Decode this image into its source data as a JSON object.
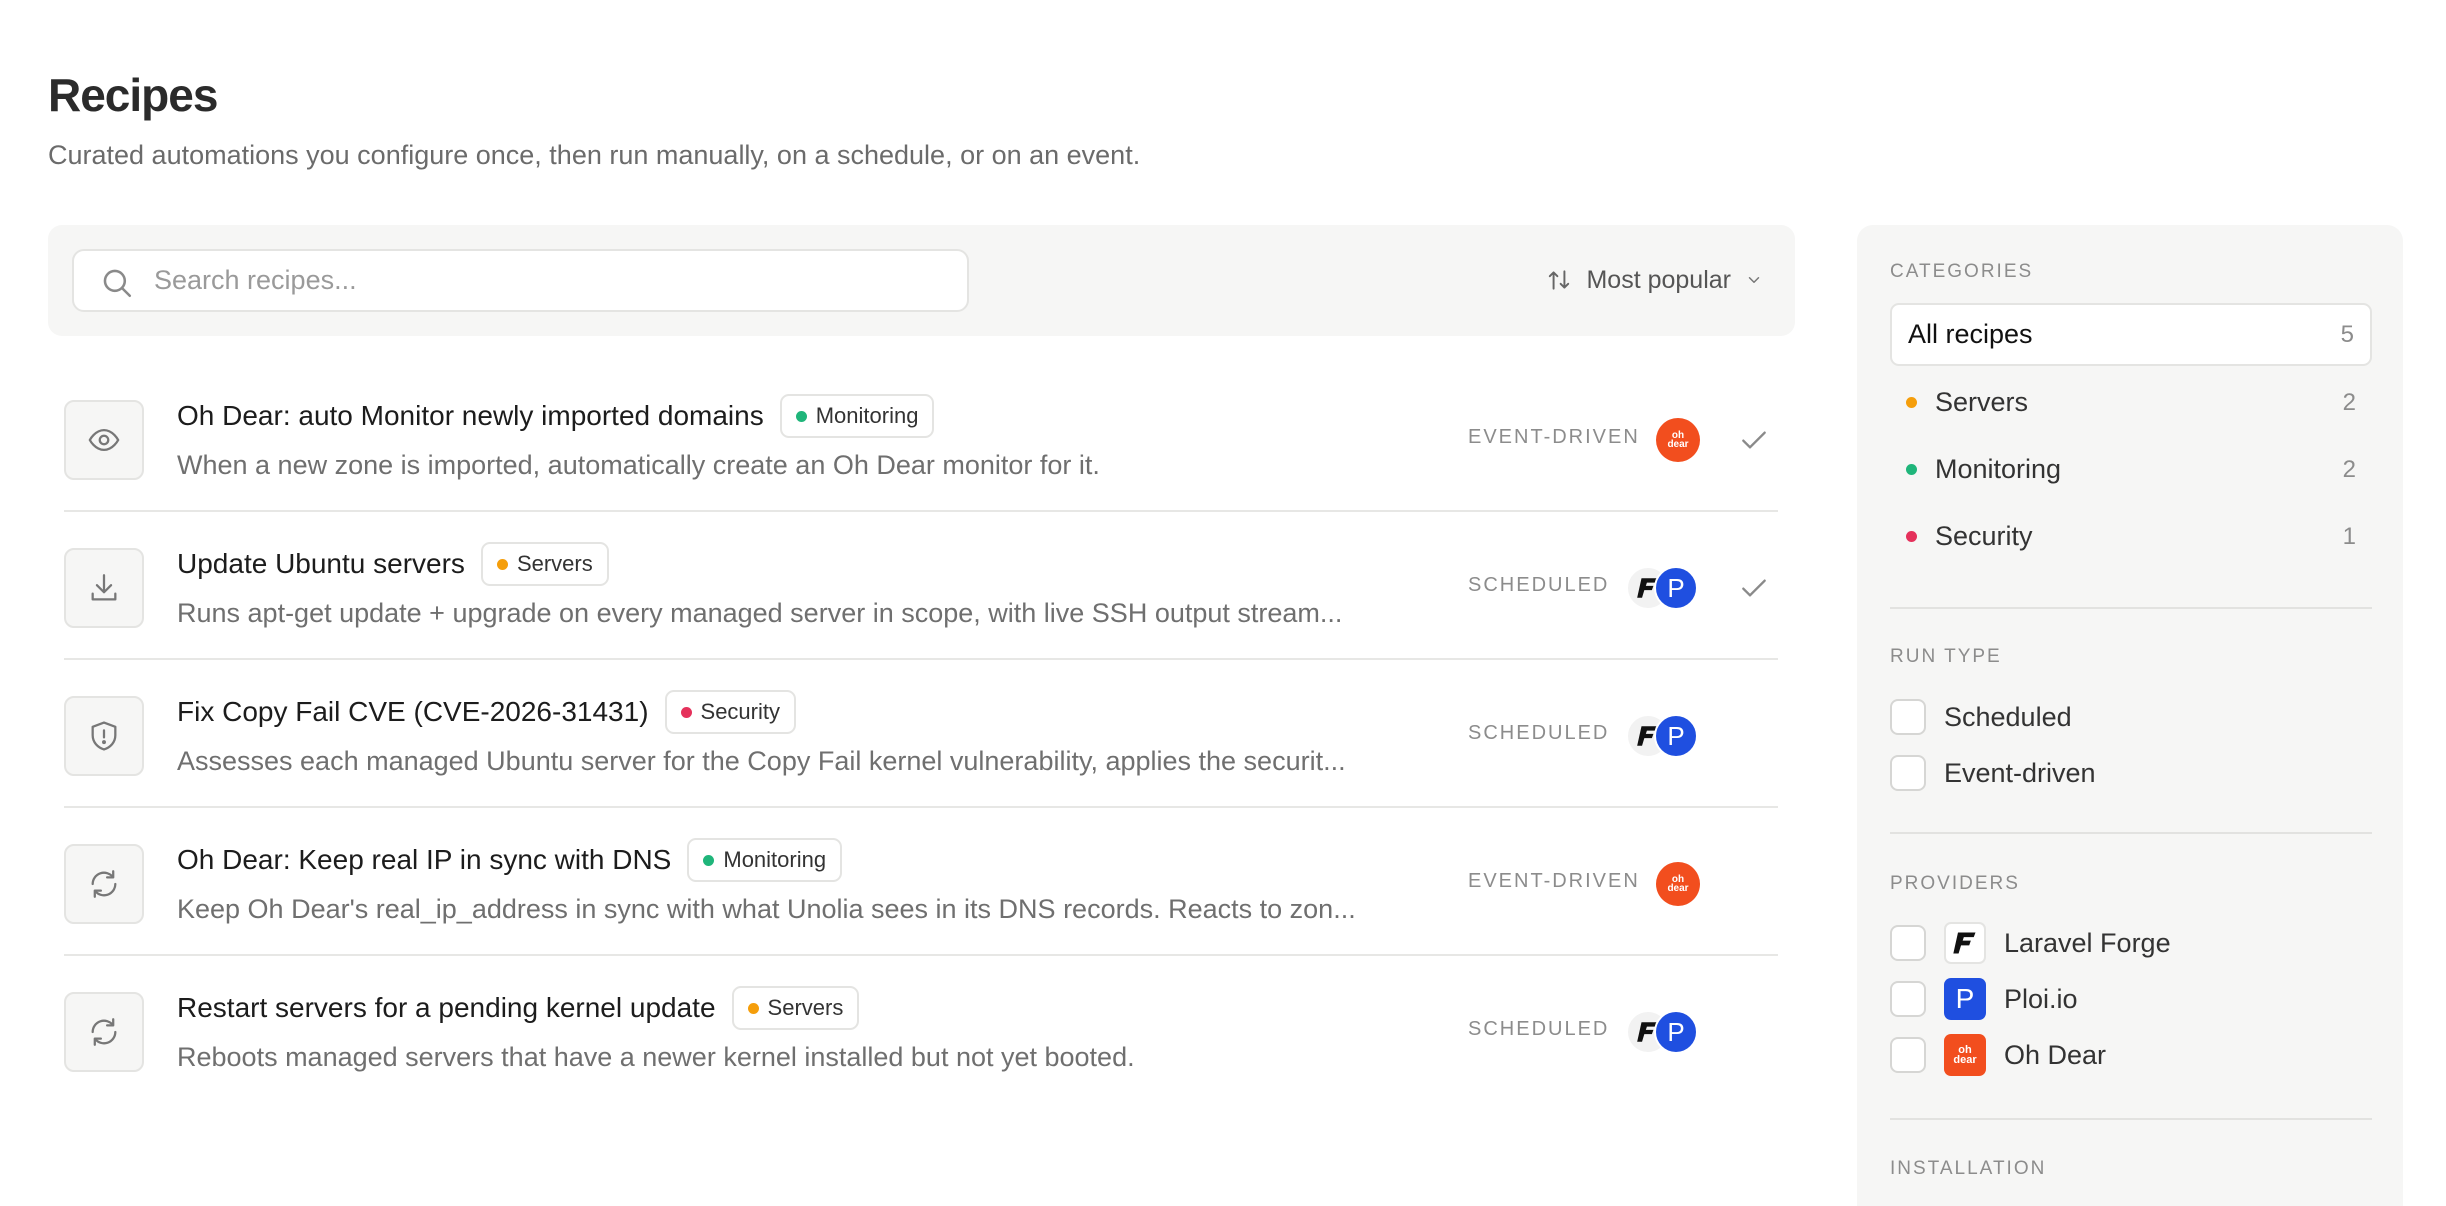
{
  "header": {
    "title": "Recipes",
    "subtitle": "Curated automations you configure once, then run manually, on a schedule, or on an event."
  },
  "toolbar": {
    "search_placeholder": "Search recipes...",
    "search_value": "",
    "sort_label": "Most popular"
  },
  "colors": {
    "monitoring": "#1fb57a",
    "servers": "#f59e0b",
    "security": "#e5315b",
    "ploi": "#1f4fe0",
    "ohdear": "#f24e1e"
  },
  "recipes": [
    {
      "title": "Oh Dear: auto Monitor newly imported domains",
      "category": "Monitoring",
      "description": "When a new zone is imported, automatically create an Oh Dear monitor for it.",
      "run_type": "EVENT-DRIVEN",
      "icon": "eye-icon",
      "providers": [
        "oh dear"
      ],
      "installed": true
    },
    {
      "title": "Update Ubuntu servers",
      "category": "Servers",
      "description": "Runs apt-get update + upgrade on every managed server in scope, with live SSH output stream...",
      "run_type": "SCHEDULED",
      "icon": "download-icon",
      "providers": [
        "F",
        "P"
      ],
      "installed": true
    },
    {
      "title": "Fix Copy Fail CVE (CVE-2026-31431)",
      "category": "Security",
      "description": "Assesses each managed Ubuntu server for the Copy Fail kernel vulnerability, applies the securit...",
      "run_type": "SCHEDULED",
      "icon": "shield-alert-icon",
      "providers": [
        "F",
        "P"
      ],
      "installed": false
    },
    {
      "title": "Oh Dear: Keep real IP in sync with DNS",
      "category": "Monitoring",
      "description": "Keep Oh Dear's real_ip_address in sync with what Unolia sees in its DNS records. Reacts to zon...",
      "run_type": "EVENT-DRIVEN",
      "icon": "refresh-icon",
      "providers": [
        "oh dear"
      ],
      "installed": false
    },
    {
      "title": "Restart servers for a pending kernel update",
      "category": "Servers",
      "description": "Reboots managed servers that have a newer kernel installed but not yet booted.",
      "run_type": "SCHEDULED",
      "icon": "refresh-icon",
      "providers": [
        "F",
        "P"
      ],
      "installed": false
    }
  ],
  "sidebar": {
    "categories_heading": "CATEGORIES",
    "categories": [
      {
        "label": "All recipes",
        "count": "5"
      },
      {
        "label": "Servers",
        "count": "2"
      },
      {
        "label": "Monitoring",
        "count": "2"
      },
      {
        "label": "Security",
        "count": "1"
      }
    ],
    "run_type_heading": "RUN TYPE",
    "run_types": [
      "Scheduled",
      "Event-driven"
    ],
    "providers_heading": "PROVIDERS",
    "providers": [
      {
        "label": "Laravel Forge",
        "logo": "F"
      },
      {
        "label": "Ploi.io",
        "logo": "P"
      },
      {
        "label": "Oh Dear",
        "logo": "oh dear"
      }
    ],
    "installation_heading": "INSTALLATION"
  }
}
